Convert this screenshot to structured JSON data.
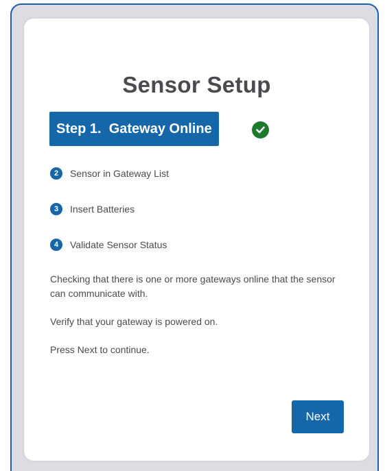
{
  "title": "Sensor Setup",
  "active_step": {
    "label": "Step 1.  Gateway Online",
    "status_icon": "check-circle-icon",
    "status_color": "#1b7a2c"
  },
  "steps": [
    {
      "num": "2",
      "label": "Sensor in Gateway List"
    },
    {
      "num": "3",
      "label": "Insert Batteries"
    },
    {
      "num": "4",
      "label": "Validate Sensor Status"
    }
  ],
  "description": [
    "Checking that there is one or more gateways online that the sensor can communicate with.",
    "Verify that your gateway is powered on.",
    "Press Next to continue."
  ],
  "buttons": {
    "next": "Next"
  },
  "colors": {
    "accent": "#1667aa",
    "frame_border": "#1c5ea8",
    "success": "#1b7a2c"
  }
}
